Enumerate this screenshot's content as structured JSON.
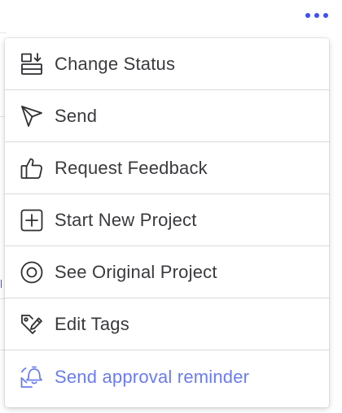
{
  "more_button": {
    "icon": "more-dots-icon",
    "color": "#3d4ff5"
  },
  "menu": {
    "items": [
      {
        "label": "Change Status",
        "icon": "change-status-icon"
      },
      {
        "label": "Send",
        "icon": "send-icon"
      },
      {
        "label": "Request Feedback",
        "icon": "thumbs-up-icon"
      },
      {
        "label": "Start New Project",
        "icon": "plus-square-icon"
      },
      {
        "label": "See Original Project",
        "icon": "target-circle-icon"
      },
      {
        "label": "Edit Tags",
        "icon": "tag-edit-icon"
      },
      {
        "label": "Send approval reminder",
        "icon": "bell-reminder-icon",
        "color": "#6b7cf0"
      }
    ]
  }
}
